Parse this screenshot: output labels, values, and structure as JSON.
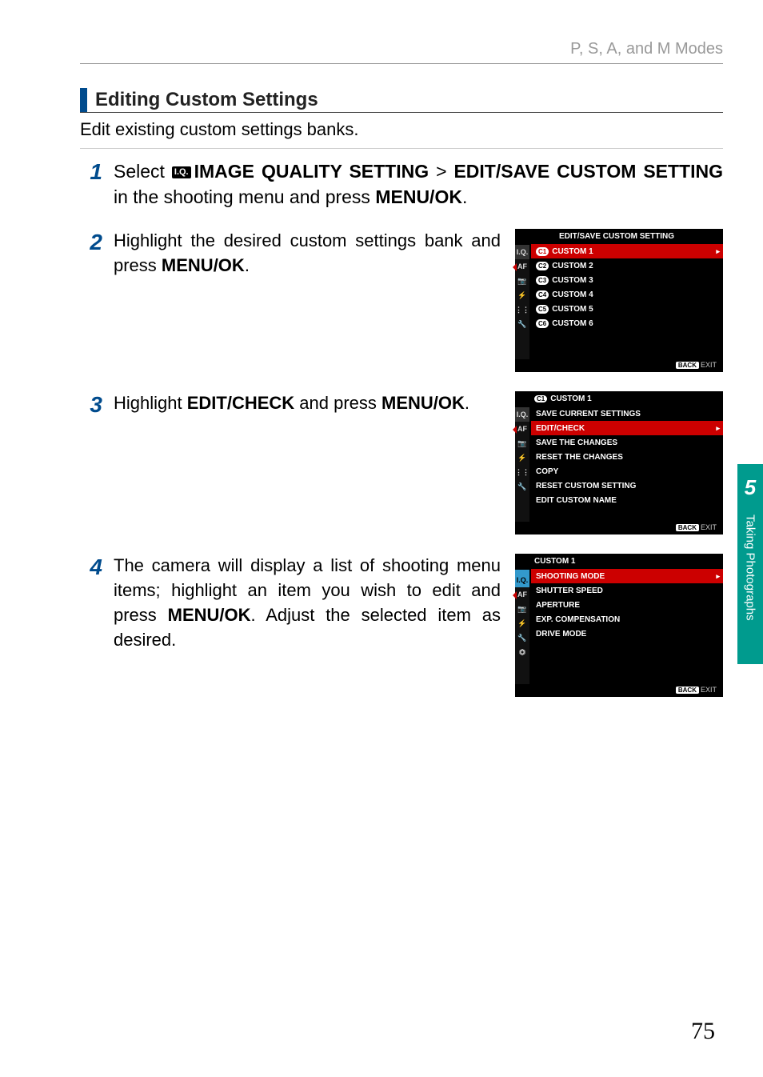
{
  "breadcrumb": "P, S, A, and M Modes",
  "section_title": "Editing Custom Settings",
  "intro": "Edit existing custom settings banks.",
  "steps": {
    "s1": {
      "num": "1",
      "pre": "Select ",
      "iq_icon": "I.Q.",
      "bold1": "IMAGE QUALITY SETTING",
      "gt": " > ",
      "bold2": "EDIT/SAVE CUSTOM SETTING",
      "mid": " in the shooting menu and press ",
      "bold3": "MENU/OK",
      "end": "."
    },
    "s2": {
      "num": "2",
      "pre": "Highlight the desired custom settings bank and press ",
      "bold": "MENU/OK",
      "end": "."
    },
    "s3": {
      "num": "3",
      "pre": "Highlight ",
      "bold1": "EDIT/CHECK",
      "mid": " and press ",
      "bold2": "MENU/OK",
      "end": "."
    },
    "s4": {
      "num": "4",
      "pre": "The camera will display a list of shooting menu items; highlight an item you wish to edit and press ",
      "bold": "MENU/OK",
      "after": ". Adjust the selected item as desired."
    }
  },
  "screen1": {
    "title": "EDIT/SAVE CUSTOM SETTING",
    "rows": [
      {
        "badge": "C1",
        "label": "CUSTOM 1",
        "selected": true,
        "chev": "▸"
      },
      {
        "badge": "C2",
        "label": "CUSTOM 2"
      },
      {
        "badge": "C3",
        "label": "CUSTOM 3"
      },
      {
        "badge": "C4",
        "label": "CUSTOM 4"
      },
      {
        "badge": "C5",
        "label": "CUSTOM 5"
      },
      {
        "badge": "C6",
        "label": "CUSTOM 6"
      }
    ],
    "footer_back": "BACK",
    "footer_exit": "EXIT",
    "sidebar": [
      "I.Q.",
      "AF MF",
      "📷",
      "⚡",
      "⋮⋮",
      "🔧"
    ]
  },
  "screen2": {
    "title_badge": "C1",
    "title": "CUSTOM 1",
    "rows": [
      {
        "label": "SAVE CURRENT SETTINGS"
      },
      {
        "label": "EDIT/CHECK",
        "selected": true,
        "chev": "▸"
      },
      {
        "label": "SAVE THE CHANGES"
      },
      {
        "label": "RESET THE CHANGES"
      },
      {
        "label": "COPY"
      },
      {
        "label": "RESET CUSTOM SETTING"
      },
      {
        "label": "EDIT CUSTOM NAME"
      }
    ],
    "footer_back": "BACK",
    "footer_exit": "EXIT",
    "sidebar": [
      "I.Q.",
      "AF MF",
      "📷",
      "⚡",
      "⋮⋮",
      "🔧"
    ]
  },
  "screen3": {
    "title": "CUSTOM 1",
    "rows": [
      {
        "label": "SHOOTING MODE",
        "selected": true,
        "chev": "▸"
      },
      {
        "label": "SHUTTER SPEED"
      },
      {
        "label": "APERTURE"
      },
      {
        "label": "EXP. COMPENSATION"
      },
      {
        "label": "DRIVE MODE"
      }
    ],
    "footer_back": "BACK",
    "footer_exit": "EXIT",
    "sidebar": [
      "",
      "I.Q.",
      "AF MF",
      "📷",
      "⚡",
      "🔧",
      "⏣"
    ]
  },
  "sidetab": {
    "chapter": "5",
    "label": "Taking Photographs"
  },
  "page_number": "75"
}
